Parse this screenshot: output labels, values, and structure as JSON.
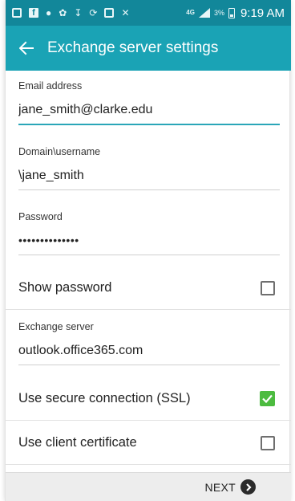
{
  "status_bar": {
    "icons": [
      "message-icon",
      "facebook-icon",
      "location-icon",
      "settings-icon",
      "download-icon",
      "sync-icon",
      "gallery-icon",
      "mute-icon"
    ],
    "network": "4G",
    "battery_percent": "3%",
    "time": "9:19 AM"
  },
  "app_bar": {
    "title": "Exchange server settings",
    "background": "#1aa3b5"
  },
  "fields": {
    "email": {
      "label": "Email address",
      "value": "jane_smith@clarke.edu"
    },
    "domain_username": {
      "label": "Domain\\username",
      "value": "\\jane_smith"
    },
    "password": {
      "label": "Password",
      "value": "••••••••••••••"
    },
    "exchange_server": {
      "label": "Exchange server",
      "value": "outlook.office365.com"
    }
  },
  "options": {
    "show_password": {
      "label": "Show password",
      "checked": false
    },
    "ssl": {
      "label": "Use secure connection (SSL)",
      "checked": true
    },
    "client_certificate": {
      "label": "Use client certificate",
      "checked": false
    }
  },
  "bottom_bar": {
    "next_label": "NEXT"
  },
  "colors": {
    "status_bar": "#12879a",
    "accent": "#2aa6b8",
    "checkbox_checked": "#4cbb3f"
  }
}
